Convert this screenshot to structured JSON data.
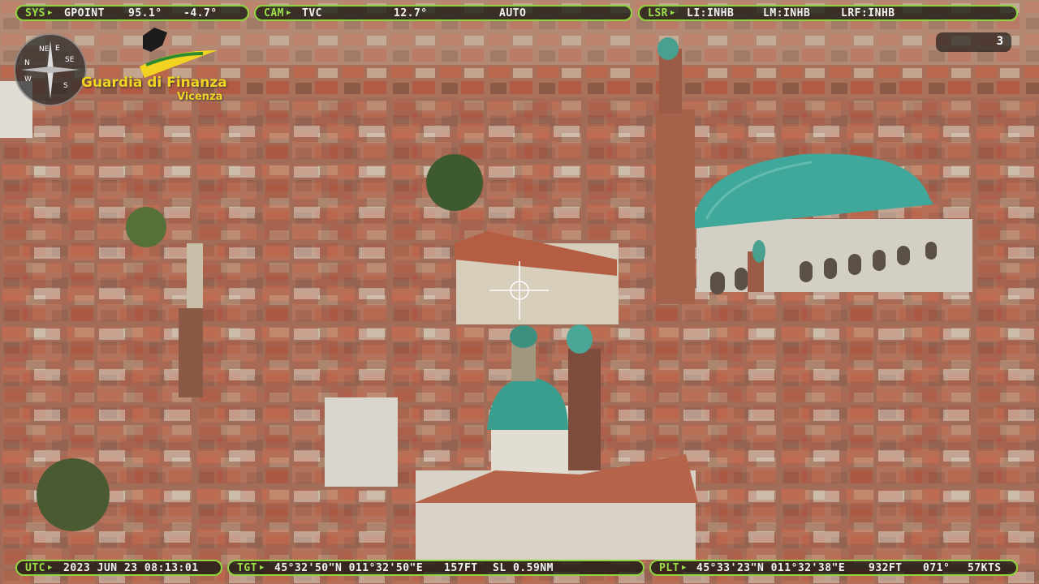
{
  "hud": {
    "sys": {
      "label": "SYS",
      "mode": "GPOINT",
      "az": "95.1°",
      "el": "-4.7°"
    },
    "cam": {
      "label": "CAM",
      "sensor": "TVC",
      "fov": "12.7°",
      "focus": "AUTO"
    },
    "lsr": {
      "label": "LSR",
      "li": "LI:INHB",
      "lm": "LM:INHB",
      "lrf": "LRF:INHB"
    },
    "utc": {
      "label": "UTC",
      "datetime": "2023 JUN 23 08:13:01"
    },
    "tgt": {
      "label": "TGT",
      "position": "45°32'50\"N 011°32'50\"E",
      "alt": "157FT",
      "slant": "SL 0.59NM"
    },
    "plt": {
      "label": "PLT",
      "position": "45°33'23\"N 011°32'38\"E",
      "alt": "932FT",
      "heading": "071°",
      "speed": "57KTS"
    },
    "counter": "3"
  },
  "logo": {
    "name": "Guardia di Finanza",
    "city": "Vicenza",
    "compass": [
      "NE",
      "E",
      "SE",
      "S",
      "W",
      "N"
    ]
  },
  "colors": {
    "hud_green": "#8fd63c",
    "dome": "#3fa89a",
    "roof": "#b5644a"
  }
}
